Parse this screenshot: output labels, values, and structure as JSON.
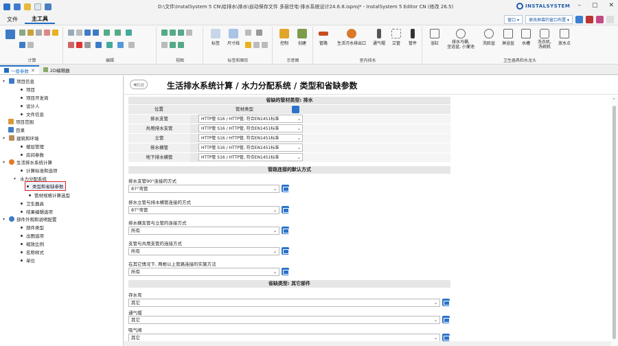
{
  "window": {
    "title": "D:\\文件\\InstalSystem 5 CN\\给排水\\排水\\自动保存文件 多层住宅-排水系统设计24.6.8.isproj* - InstalSystem 5 Editor CN (修改 26.5)",
    "logo_text": "INSTALSYSTEM",
    "minimize": "–",
    "maximize": "▢",
    "close": "✕"
  },
  "menu": {
    "file": "文件",
    "tools": "主工具",
    "window_dropdown": "窗口",
    "layout_dropdown": "更改屏幕的窗口布置"
  },
  "ribbon": {
    "groups": {
      "calc": "计算",
      "edit": "编辑",
      "view": "视图",
      "label_shape": "标签和图形",
      "schematic": "示意图",
      "indoor_drain": "室内排水",
      "fixtures": "卫生器具和水龙头"
    },
    "buttons": {
      "label": "标签",
      "dimension": "尺寸线",
      "control": "控制",
      "create": "创建",
      "pipe": "管路",
      "outlet": "生活污水排出口",
      "vent_cap": "通气帽",
      "riser": "立管",
      "fitting": "管件",
      "bathtub": "浴缸",
      "toilet": "排水马桶,\n坐浴盆, 小便池",
      "washbasin": "洗脸盆",
      "shower": "淋浴盆",
      "sink": "水槽",
      "washer": "洗衣机,\n洗碗机",
      "faucet": "放水点"
    }
  },
  "tabs": [
    {
      "label": "一般参数",
      "active": true
    },
    {
      "label": "2D编辑器",
      "active": false
    }
  ],
  "tree": {
    "items": [
      {
        "label": "项目信息",
        "kind": "folder",
        "expanded": true
      },
      {
        "label": "项目",
        "kind": "leaf"
      },
      {
        "label": "项目开发商",
        "kind": "leaf"
      },
      {
        "label": "设计人",
        "kind": "leaf"
      },
      {
        "label": "文件信息",
        "kind": "leaf"
      },
      {
        "label": "项目范围",
        "kind": "folder"
      },
      {
        "label": "目录",
        "kind": "folder"
      },
      {
        "label": "建筑和环境",
        "kind": "folder",
        "expanded": true
      },
      {
        "label": "楼层管理",
        "kind": "leaf"
      },
      {
        "label": "房间参数",
        "kind": "leaf"
      },
      {
        "label": "生活排水系统计算",
        "kind": "folder",
        "expanded": true
      },
      {
        "label": "计算标准和选项",
        "kind": "leaf"
      },
      {
        "label": "水力分配系统",
        "kind": "folder",
        "expanded": true
      },
      {
        "label": "类型和省缺参数",
        "kind": "leaf",
        "selected": true
      },
      {
        "label": "管材规格计算选型",
        "kind": "leaf"
      },
      {
        "label": "卫生器具",
        "kind": "leaf"
      },
      {
        "label": "结果编辑选项",
        "kind": "leaf"
      },
      {
        "label": "部件外观和说明配置",
        "kind": "folder",
        "expanded": true
      },
      {
        "label": "部件类型",
        "kind": "leaf"
      },
      {
        "label": "出图选项",
        "kind": "leaf"
      },
      {
        "label": "缩放比例",
        "kind": "leaf"
      },
      {
        "label": "名称样式",
        "kind": "leaf"
      },
      {
        "label": "单位",
        "kind": "leaf"
      }
    ]
  },
  "main": {
    "back": "后退",
    "title": "生活排水系统计算 / 水力分配系统 / 类型和省缺参数",
    "section1": {
      "title": "省缺的管材类型: 排水",
      "col_position": "位置",
      "col_type": "管材类型",
      "rows": [
        {
          "position": "排水支管",
          "value": "HTTP管 S16 / HTTP管, 符合EN1451标准"
        },
        {
          "position": "共用排水支管",
          "value": "HTTP管 S16 / HTTP管, 符合EN1451标准"
        },
        {
          "position": "立管",
          "value": "HTTP管 S16 / HTTP管, 符合EN1451标准"
        },
        {
          "position": "排水横管",
          "value": "HTTP管 S16 / HTTP管, 符合EN1451标准"
        },
        {
          "position": "地下排水横管",
          "value": "HTTP管 S16 / HTTP管, 符合EN1451标准"
        }
      ]
    },
    "section2": {
      "title": "管路连接的默认方式",
      "fields": [
        {
          "label": "排水支管90°连接的方式",
          "value": "87°弯管"
        },
        {
          "label": "排水立管与排水横管连接的方式",
          "value": "87°弯管"
        },
        {
          "label": "排水横支管与立管的连接方式",
          "value": "所有"
        },
        {
          "label": "支管与共用支管的连接方式",
          "value": "所有"
        },
        {
          "label": "在其它情况下, 两根以上管路连接的实施方法",
          "value": "所有"
        }
      ]
    },
    "section3": {
      "title": "省缺类型: 其它部件",
      "fields": [
        {
          "label": "存水弯",
          "value": "其它"
        },
        {
          "label": "通气帽",
          "value": "其它"
        },
        {
          "label": "吸气阀",
          "value": "其它"
        }
      ]
    }
  },
  "colors": {
    "accent": "#1f6fc5",
    "button_blue": "#2b73c8",
    "selection_border": "#dd2222"
  }
}
